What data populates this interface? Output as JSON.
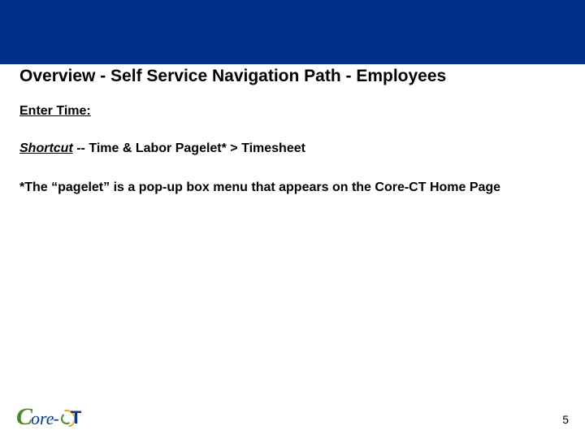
{
  "header": {
    "title": "Overview - Self Service Navigation Path - Employees"
  },
  "body": {
    "section_label": "Enter Time:",
    "shortcut_label": "Shortcut",
    "shortcut_rest": " -- Time & Labor Pagelet* > Timesheet",
    "note": "*The “pagelet” is a pop-up box menu that appears on the Core-CT Home Page"
  },
  "footer": {
    "logo_c": "C",
    "logo_ore": "ore",
    "logo_hyphen": "-",
    "logo_t": "T",
    "page_number": "5"
  }
}
